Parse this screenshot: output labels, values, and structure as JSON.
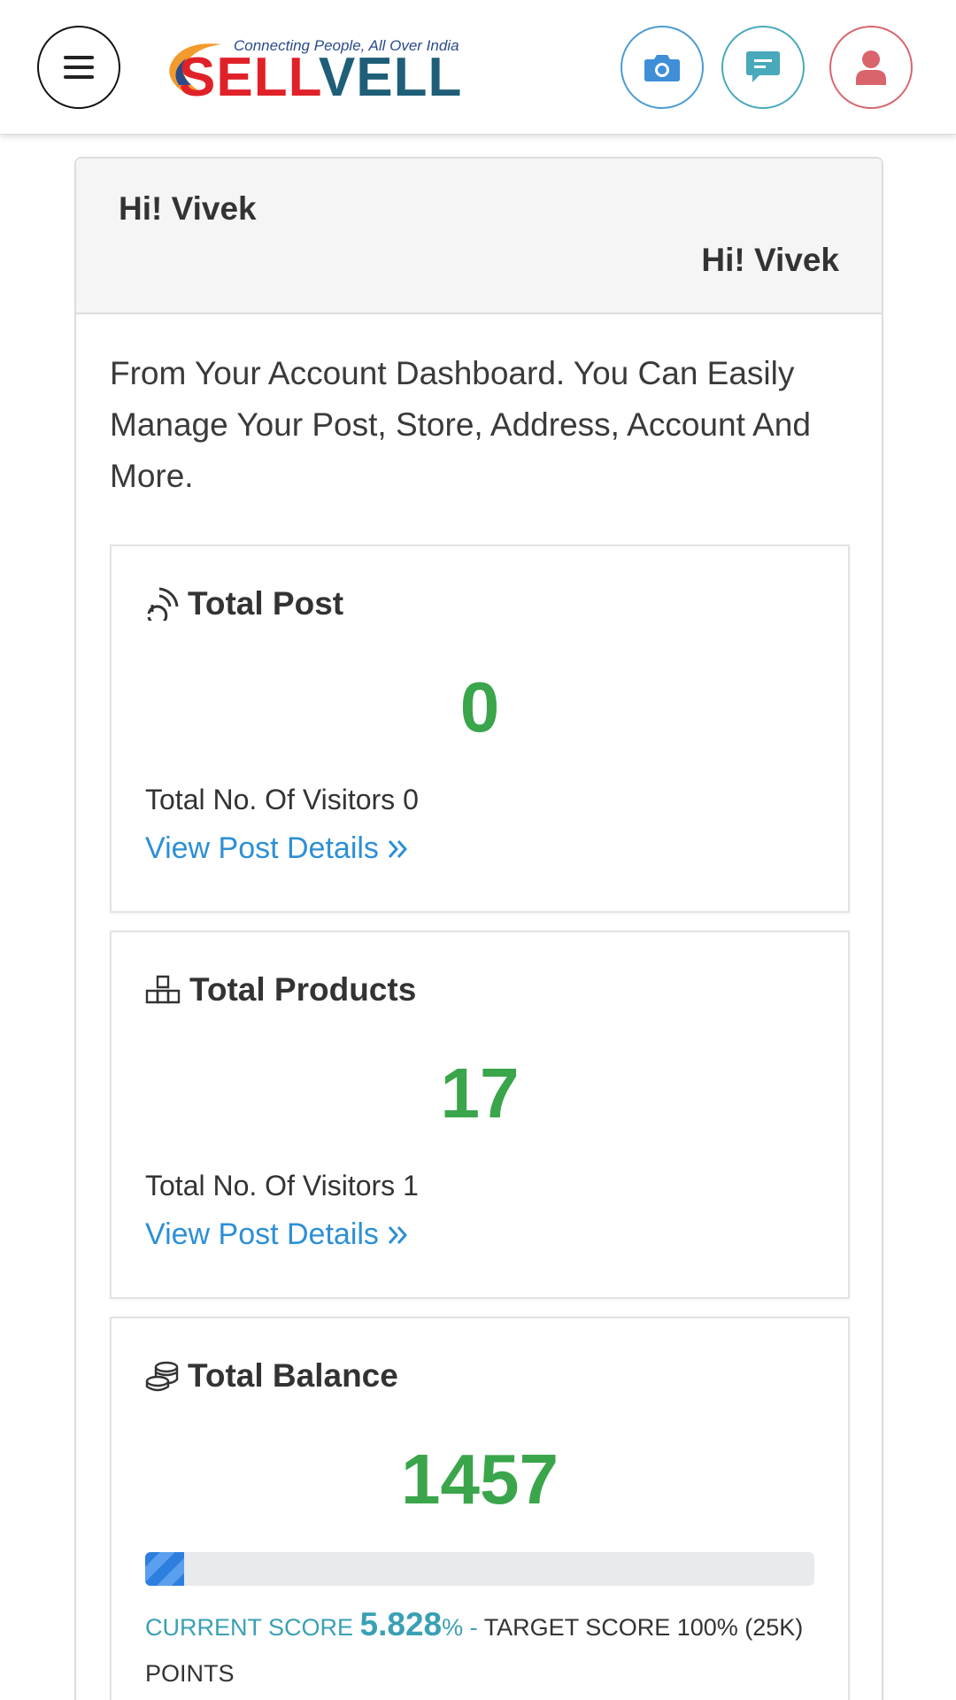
{
  "header": {
    "logo": {
      "tagline": "Connecting People, All Over India",
      "word_part1": "SELL",
      "word_part2": "VELL"
    },
    "icons": [
      "menu-icon",
      "camera-icon",
      "chat-icon",
      "user-icon"
    ],
    "colors": {
      "camera_accent": "#4a9bd4",
      "chat_accent": "#48a9bb",
      "user_accent": "#d9646c",
      "brand_red": "#e02128",
      "brand_teal": "#1f5e78"
    }
  },
  "dashboard": {
    "greeting_left": "Hi! Vivek",
    "greeting_right": "Hi! Vivek",
    "intro": "From Your Account Dashboard. You Can Easily Manage Your Post, Store, Address, Account And More.",
    "total_post": {
      "title": "Total Post",
      "icon": "rss-icon",
      "value": "0",
      "visitors": "Total No. Of Visitors 0",
      "link": "View Post Details"
    },
    "total_products": {
      "title": "Total Products",
      "icon": "boxes-icon",
      "value": "17",
      "visitors": "Total No. Of Visitors 1",
      "link": "View Post Details"
    },
    "total_balance": {
      "title": "Total Balance",
      "icon": "coins-icon",
      "value": "1457",
      "progress_percent": 5.828,
      "current_score_label": "CURRENT SCORE",
      "current_score_value": "5.828",
      "percent_sign": "%",
      "separator": "-",
      "target_text": "TARGET SCORE 100% (25K) POINTS"
    },
    "colors": {
      "value_green": "#3aa54a",
      "link_blue": "#2d8fd6",
      "score_teal": "#3aa0b4",
      "progress_blue": "#2d7fdd"
    }
  }
}
